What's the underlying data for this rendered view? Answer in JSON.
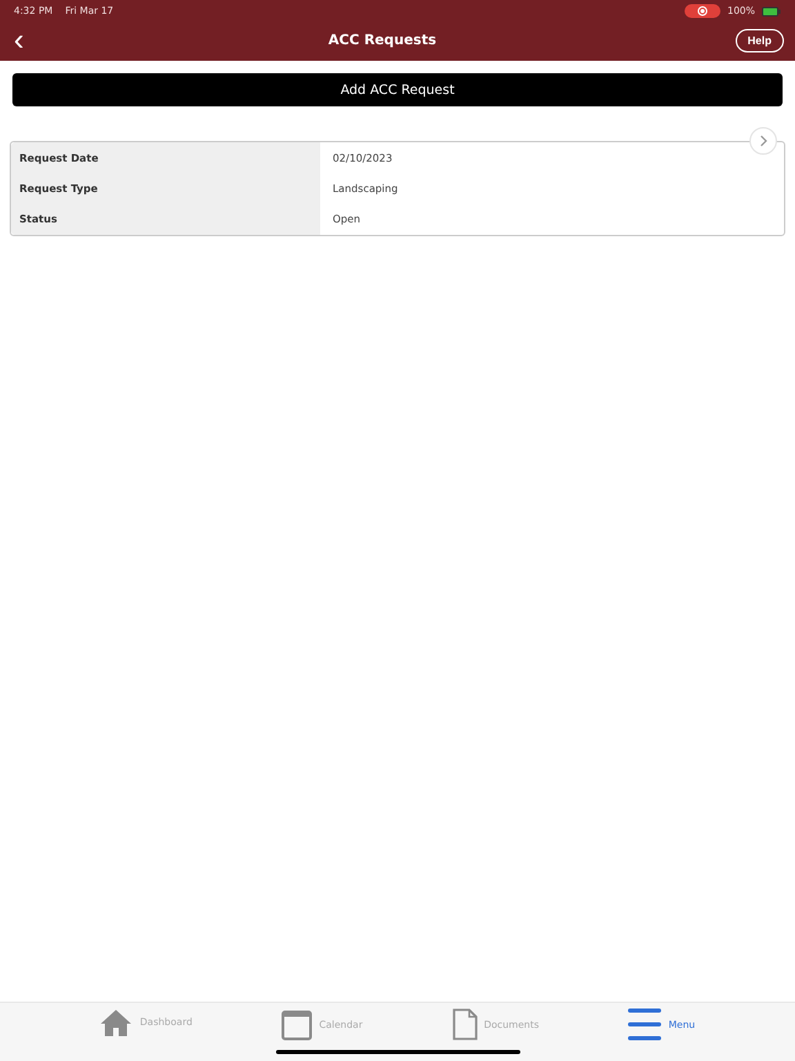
{
  "status_bar": {
    "time": "4:32 PM",
    "date": "Fri Mar 17",
    "battery": "100%"
  },
  "nav": {
    "back": "‹",
    "title": "ACC Requests",
    "help": "Help"
  },
  "add_button": "Add ACC Request",
  "request": {
    "rows": [
      {
        "label": "Request Date",
        "value": "02/10/2023"
      },
      {
        "label": "Request Type",
        "value": "Landscaping"
      },
      {
        "label": "Status",
        "value": "Open"
      }
    ]
  },
  "tabs": [
    {
      "label": "Dashboard",
      "kind": "home",
      "selected": false
    },
    {
      "label": "Calendar",
      "kind": "calendar",
      "selected": false
    },
    {
      "label": "Documents",
      "kind": "document",
      "selected": false
    },
    {
      "label": "Menu",
      "kind": "menu",
      "selected": true
    }
  ]
}
